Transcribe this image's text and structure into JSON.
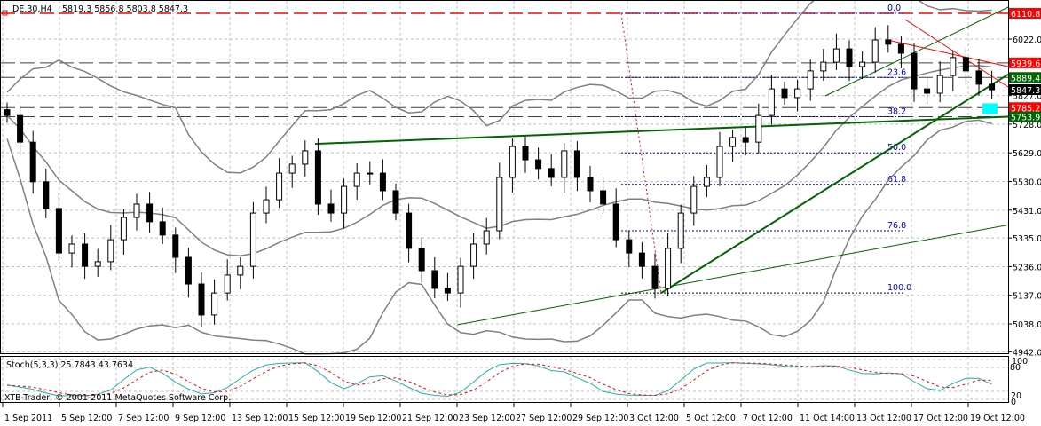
{
  "header": {
    "symbol": "DE.30,H4",
    "ohlc": "5819.3 5856.8 5803.8 5847.3"
  },
  "stoch": {
    "label": "Stoch(5,3,3) 25.7843 43.7634",
    "levels": [
      "100",
      "80",
      "20",
      "0"
    ]
  },
  "copyright": "XTB-Trader, © 2001-2011 MetaQuotes Software Corp.",
  "colors": {
    "bull": "#ffffff",
    "bear": "#000000",
    "bands": "#808080",
    "trend": "#006400",
    "red": "#ff0000",
    "fib": "#0000cd",
    "stoch_main": "#20b2aa",
    "stoch_signal": "#ff0000",
    "highlight": "#00ffff"
  },
  "chart_data": {
    "type": "candlestick",
    "ylim": [
      4942,
      6140
    ],
    "price_ticks": [
      "6022.0",
      "5827.0",
      "5728.0",
      "5629.0",
      "5530.0",
      "5431.0",
      "5335.0",
      "5236.0",
      "5137.0",
      "5038.0",
      "4942.0"
    ],
    "price_labels": [
      {
        "text": "6110.8",
        "value": 6110.8,
        "bg": "#ff0000"
      },
      {
        "text": "5939.6",
        "value": 5939.6,
        "bg": "#ff0000"
      },
      {
        "text": "5889.4",
        "value": 5889.4,
        "bg": "#006400"
      },
      {
        "text": "5847.3",
        "value": 5847.3,
        "bg": "#000000"
      },
      {
        "text": "5785.2",
        "value": 5785.2,
        "bg": "#ff0000"
      },
      {
        "text": "5753.9",
        "value": 5753.9,
        "bg": "#006400"
      }
    ],
    "time_labels": [
      "1 Sep 2011",
      "5 Sep 12:00",
      "7 Sep 12:00",
      "9 Sep 12:00",
      "13 Sep 12:00",
      "15 Sep 12:00",
      "19 Sep 12:00",
      "21 Sep 12:00",
      "23 Sep 12:00",
      "27 Sep 12:00",
      "29 Sep 12:00",
      "3 Oct 12:00",
      "5 Oct 12:00",
      "7 Oct 12:00",
      "11 Oct 14:00",
      "13 Oct 12:00",
      "17 Oct 12:00",
      "19 Oct 12:00"
    ],
    "fib_levels": [
      {
        "label": "0.0",
        "value": 6110.8
      },
      {
        "label": "23.6",
        "value": 5889.4
      },
      {
        "label": "38.2",
        "value": 5753.9
      },
      {
        "label": "50.0",
        "value": 5629
      },
      {
        "label": "61.8",
        "value": 5520
      },
      {
        "label": "76.8",
        "value": 5360
      },
      {
        "label": "100.0",
        "value": 5145
      }
    ],
    "close": [
      5758,
      5666,
      5529,
      5437,
      5283,
      5314,
      5237,
      5253,
      5329,
      5406,
      5452,
      5391,
      5345,
      5268,
      5176,
      5069,
      5145,
      5207,
      5237,
      5421,
      5467,
      5559,
      5590,
      5636,
      5452,
      5421,
      5513,
      5559,
      5559,
      5498,
      5421,
      5299,
      5222,
      5161,
      5145,
      5237,
      5314,
      5360,
      5544,
      5651,
      5605,
      5575,
      5544,
      5636,
      5544,
      5498,
      5452,
      5329,
      5283,
      5237,
      5161,
      5299,
      5421,
      5513,
      5544,
      5651,
      5682,
      5666,
      5758,
      5850,
      5820,
      5850,
      5912,
      5942,
      5988,
      5927,
      5942,
      6019,
      6004,
      5973,
      5850,
      5835,
      5896,
      5958,
      5912,
      5866,
      5847
    ]
  }
}
